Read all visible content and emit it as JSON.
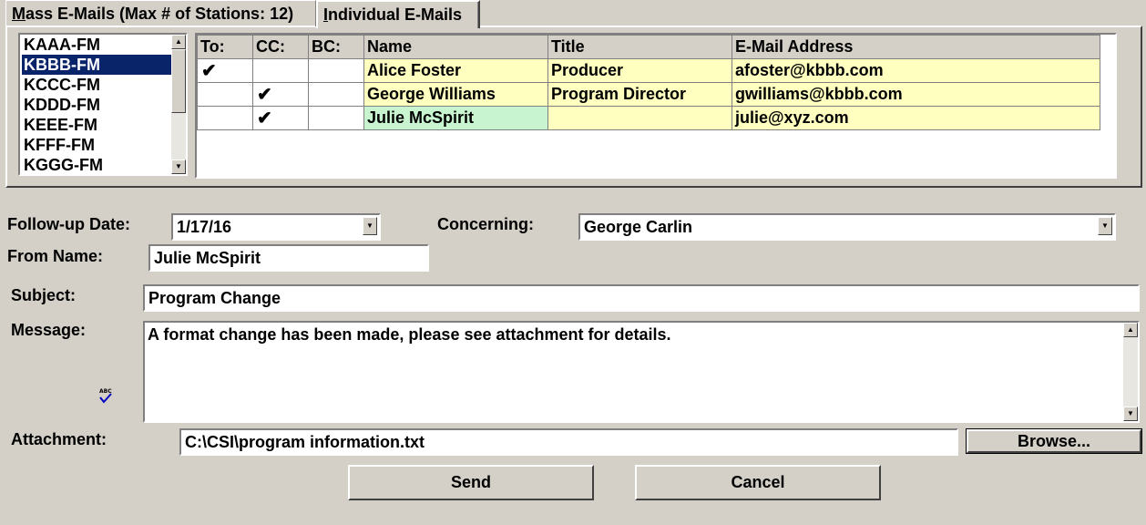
{
  "tabs": {
    "mass": "Mass E-Mails (Max # of Stations: 12)",
    "individual": "Individual E-Mails"
  },
  "stations": [
    "KAAA-FM",
    "KBBB-FM",
    "KCCC-FM",
    "KDDD-FM",
    "KEEE-FM",
    "KFFF-FM",
    "KGGG-FM"
  ],
  "selected_station": "KBBB-FM",
  "grid": {
    "headers": [
      "To:",
      "CC:",
      "BC:",
      "Name",
      "Title",
      "E-Mail Address"
    ],
    "rows": [
      {
        "to": "✔",
        "cc": "",
        "bc": "",
        "name": "Alice Foster",
        "title": "Producer",
        "email": "afoster@kbbb.com"
      },
      {
        "to": "",
        "cc": "✔",
        "bc": "",
        "name": "George Williams",
        "title": "Program Director",
        "email": "gwilliams@kbbb.com"
      },
      {
        "to": "",
        "cc": "✔",
        "bc": "",
        "name": "Julie McSpirit",
        "title": "",
        "email": "julie@xyz.com"
      }
    ]
  },
  "form": {
    "followup_label": "Follow-up Date:",
    "followup_value": "1/17/16",
    "concerning_label": "Concerning:",
    "concerning_value": "George Carlin",
    "from_label": "From Name:",
    "from_value": "Julie McSpirit",
    "subject_label": "Subject:",
    "subject_value": "Program Change",
    "message_label": "Message:",
    "message_value": "A format change has been made, please see attachment for details.",
    "attachment_label": "Attachment:",
    "attachment_value": "C:\\CSI\\program information.txt",
    "spell_check_icon_text": "ABC"
  },
  "buttons": {
    "browse": "Browse...",
    "send": "Send",
    "cancel": "Cancel"
  },
  "colors": {
    "selection": "#0a246a",
    "existing_contact": "#ffffc0",
    "new_contact": "#c8f5d0"
  }
}
